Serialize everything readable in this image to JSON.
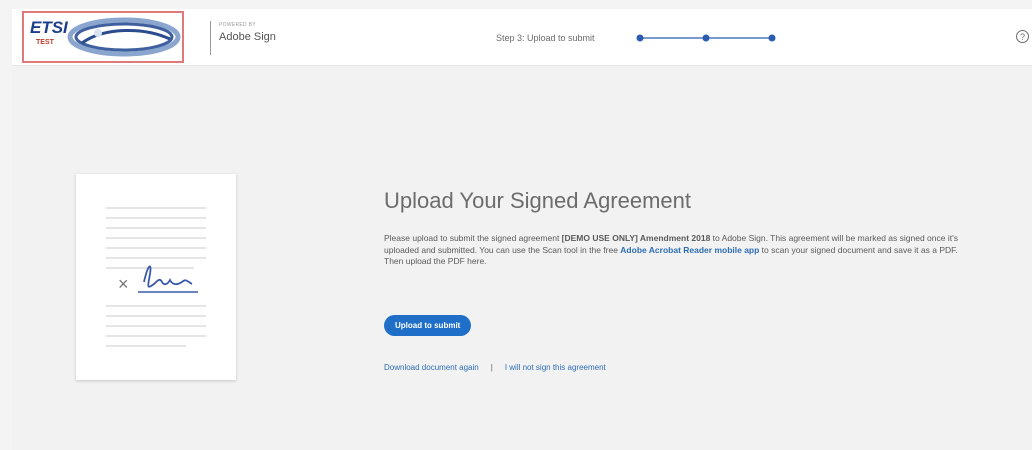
{
  "header": {
    "logo_text": "ETSI",
    "logo_subtext": "TEST",
    "powered_by": "POWERED BY",
    "brand": "Adobe Sign",
    "step_label": "Step 3: Upload to submit",
    "progress_steps": 3,
    "progress_current": 3
  },
  "main": {
    "title": "Upload Your Signed Agreement",
    "description": {
      "part1": "Please upload to submit the signed agreement ",
      "agreement_name": "[DEMO USE ONLY] Amendment 2018",
      "part2": " to Adobe Sign. This agreement will be marked as signed once it's uploaded and submitted. You can use the Scan tool in the free ",
      "app_link": "Adobe Acrobat Reader mobile app",
      "part3": " to scan your signed document and save it as a PDF. Then upload the PDF here."
    },
    "upload_button": "Upload to submit",
    "download_link": "Download document again",
    "separator": "|",
    "decline_link": "I will not sign this agreement"
  },
  "colors": {
    "accent": "#1f6fc8",
    "link": "#2d6db5",
    "progress": "#2a5db0"
  }
}
